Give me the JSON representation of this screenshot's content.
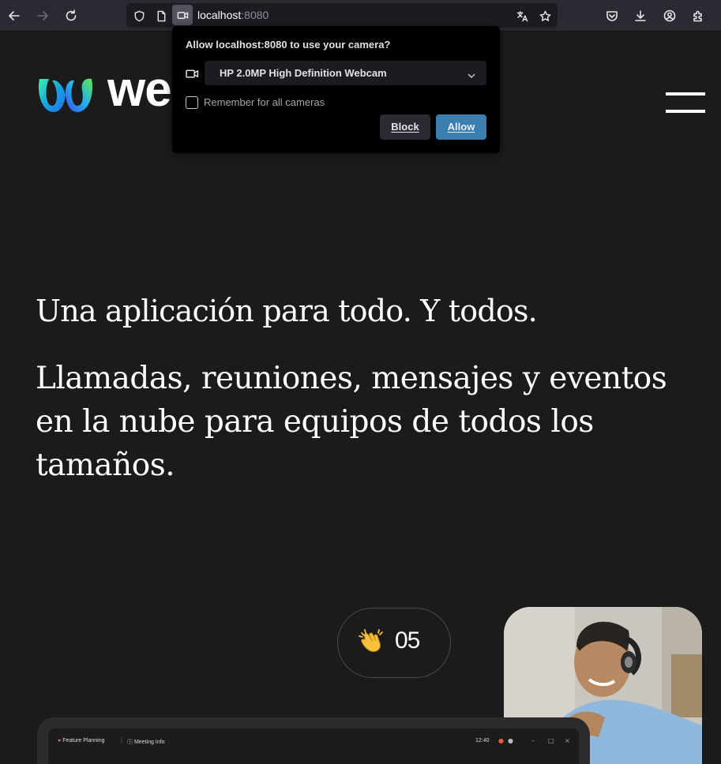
{
  "browser": {
    "url_host": "localhost",
    "url_port": ":8080",
    "icons": [
      "back-icon",
      "forward-icon",
      "reload-icon",
      "shield-icon",
      "page-icon",
      "camera-icon",
      "translate-icon",
      "star-icon",
      "pocket-icon",
      "download-icon",
      "account-icon",
      "extensions-icon"
    ]
  },
  "permission_popup": {
    "title": "Allow localhost:8080 to use your camera?",
    "device_selected": "HP 2.0MP High Definition Webcam",
    "remember_label": "Remember for all cameras",
    "remember_checked": false,
    "block_label": "Block",
    "allow_label": "Allow",
    "allow_color": "#3b7eb0"
  },
  "page": {
    "brand_text": "we",
    "hero_title": "Una aplicación para todo. Y todos.",
    "hero_subtitle": "Llamadas, reuniones, mensajes y eventos en la nube para equipos de todos los tamaños.",
    "clap_emoji": "clap-icon",
    "clap_count": "05",
    "app_preview": {
      "tab1": "Feature Planning",
      "tab2": "Meeting Info",
      "time": "12:40"
    }
  }
}
